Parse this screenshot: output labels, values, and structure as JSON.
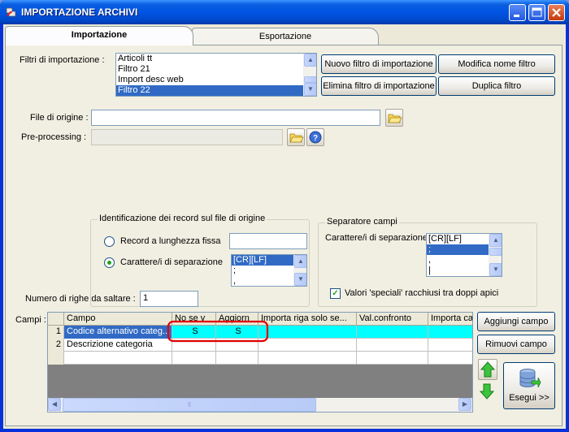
{
  "window": {
    "title": "IMPORTAZIONE ARCHIVI"
  },
  "tabs": [
    {
      "label": "Importazione",
      "active": true
    },
    {
      "label": "Esportazione",
      "active": false
    }
  ],
  "filters": {
    "label": "Filtri di importazione :",
    "items": [
      "Articoli tt",
      "Filtro 21",
      "Import desc web",
      "Filtro 22"
    ],
    "selected": "Filtro 22"
  },
  "buttons": {
    "new_filter": "Nuovo filtro di importazione",
    "rename_filter": "Modifica nome filtro",
    "delete_filter": "Elimina filtro di importazione",
    "duplicate_filter": "Duplica filtro",
    "add_field": "Aggiungi campo",
    "remove_field": "Rimuovi campo",
    "execute": "Esegui >>"
  },
  "source_file": {
    "label": "File di origine :",
    "value": ""
  },
  "preprocessing": {
    "label": "Pre-processing :",
    "value": ""
  },
  "record_identification": {
    "title": "Identificazione dei record sul file di origine",
    "fixed_length_label": "Record a lunghezza fissa",
    "fixed_length_value": "",
    "separator_label": "Carattere/i di separazione",
    "selected_option": "separator",
    "separator_items": [
      "[CR][LF]",
      ";",
      ","
    ]
  },
  "field_separator": {
    "title": "Separatore campi",
    "label": "Carattere/i di separazione",
    "items": [
      "[CR][LF]",
      ";",
      ",",
      "|"
    ],
    "quoted_label": "Valori 'speciali' racchiusi tra doppi apici",
    "quoted_checked": true
  },
  "skip_rows": {
    "label": "Numero di righe da saltare :",
    "value": "1"
  },
  "fields_grid": {
    "label": "Campi :",
    "columns": [
      "Campo",
      "No se v",
      "Aggiorn",
      "Importa riga solo se...",
      "Val.confronto",
      "Importa ca"
    ],
    "rows": [
      {
        "num": "1",
        "campo": "Codice alternativo categ...",
        "nosev": "S",
        "aggiorna": "S",
        "importa": "",
        "valconf": "",
        "importaca": ""
      },
      {
        "num": "2",
        "campo": "Descrizione categoria",
        "nosev": "",
        "aggiorna": "",
        "importa": "",
        "valconf": "",
        "importaca": ""
      }
    ]
  },
  "colors": {
    "accent": "#316ac5",
    "highlight_row": "#00ffff",
    "annotation": "#e00000"
  }
}
